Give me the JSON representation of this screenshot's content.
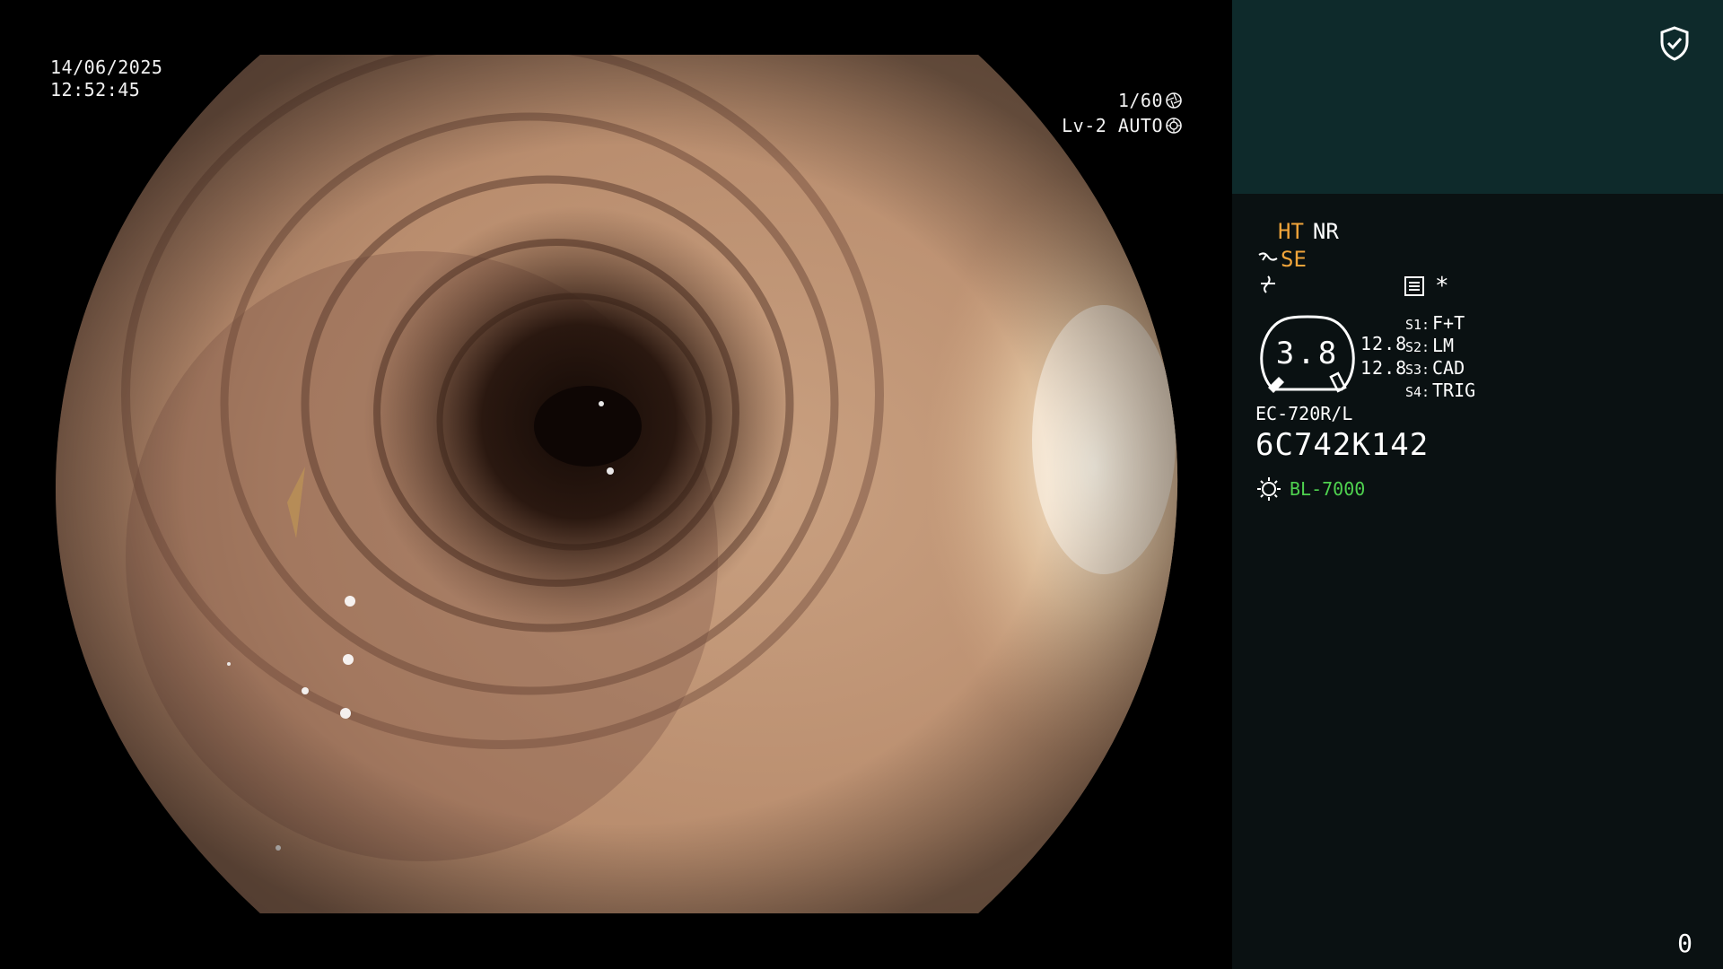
{
  "overlay": {
    "date": "14/06/2025",
    "time": "12:52:45",
    "shutter": "1/60",
    "brightness": "Lv-2 AUTO"
  },
  "panel": {
    "ht_label": "HT",
    "nr_label": "NR",
    "se_label": "SE",
    "gauge_value": "3.8",
    "num_top": "12.8",
    "num_bottom": "12.8",
    "switches": [
      {
        "key": "S1:",
        "value": "F+T"
      },
      {
        "key": "S2:",
        "value": "LM"
      },
      {
        "key": "S3:",
        "value": "CAD"
      },
      {
        "key": "S4:",
        "value": "TRIG"
      }
    ],
    "asterisk": "*",
    "scope_model": "EC-720R/L",
    "scope_serial": "6C742K142",
    "light_source": "BL-7000",
    "counter": "0"
  },
  "colors": {
    "panel_top": "#0e2a2b",
    "panel_bg": "#0a1112",
    "orange": "#f0a43a",
    "green": "#4fd24f"
  },
  "icons": [
    "shield-check-icon",
    "aperture-icon",
    "iris-icon",
    "scope-icon",
    "flash-icon",
    "menu-icon",
    "gauge-icon",
    "lamp-icon"
  ]
}
